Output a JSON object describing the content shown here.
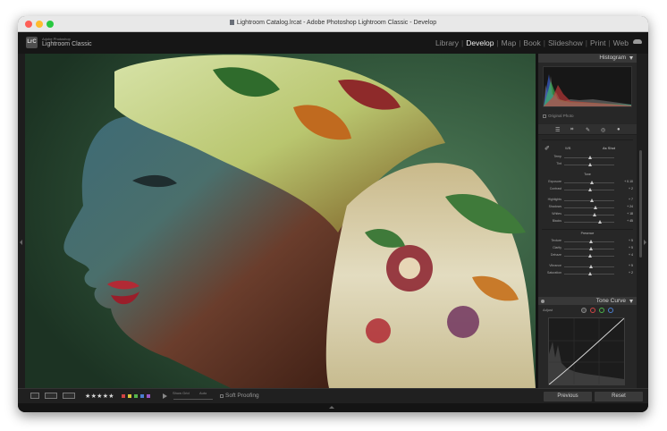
{
  "window": {
    "title": "Lightroom Catalog.lrcat - Adobe Photoshop Lightroom Classic - Develop"
  },
  "app": {
    "logo_text": "LrC",
    "brand_line1": "Adobe Photoshop",
    "brand_line2": "Lightroom Classic"
  },
  "modules": [
    "Library",
    "Develop",
    "Map",
    "Book",
    "Slideshow",
    "Print",
    "Web"
  ],
  "active_module": "Develop",
  "histogram": {
    "title": "Histogram",
    "original_photo_label": "Original Photo"
  },
  "basic": {
    "wb_label": "WB",
    "wb_value": "As Shot",
    "temp": {
      "label": "Temp",
      "value": "",
      "level": 0.52
    },
    "tint": {
      "label": "Tint",
      "value": "",
      "level": 0.52
    },
    "tone_label": "Tone",
    "exposure": {
      "label": "Exposure",
      "value": "+ 0.10",
      "level": 0.55
    },
    "contrast": {
      "label": "Contrast",
      "value": "+ 2",
      "level": 0.52
    },
    "highlights": {
      "label": "Highlights",
      "value": "+ 7",
      "level": 0.55
    },
    "shadows": {
      "label": "Shadows",
      "value": "+ 24",
      "level": 0.62
    },
    "whites": {
      "label": "Whites",
      "value": "+ 18",
      "level": 0.6
    },
    "blacks": {
      "label": "Blacks",
      "value": "+ 45",
      "level": 0.72
    },
    "presence_label": "Presence",
    "texture": {
      "label": "Texture",
      "value": "+ 5",
      "level": 0.53
    },
    "clarity": {
      "label": "Clarity",
      "value": "+ 5",
      "level": 0.53
    },
    "dehaze": {
      "label": "Dehaze",
      "value": "+ 4",
      "level": 0.52
    },
    "vibrance": {
      "label": "Vibrance",
      "value": "+ 5",
      "level": 0.53
    },
    "saturation": {
      "label": "Saturation",
      "value": "+ 2",
      "level": 0.51
    }
  },
  "tone_curve": {
    "title": "Tone Curve",
    "adjust_label": "Adjust"
  },
  "toolbar": {
    "stars": "★★★★★",
    "slider_label_top": "Show Grid",
    "slider_label_auto": "Auto",
    "soft_proofing_label": "Soft Proofing",
    "flag_colors": [
      "#d04444",
      "#d8c93a",
      "#56b54b",
      "#4b7ed1",
      "#9a56c4"
    ]
  },
  "buttons": {
    "previous": "Previous",
    "reset": "Reset"
  },
  "colors": {
    "accent_active": "#f0f0f0",
    "panel_bg": "#272727",
    "header_bg": "#383838"
  }
}
